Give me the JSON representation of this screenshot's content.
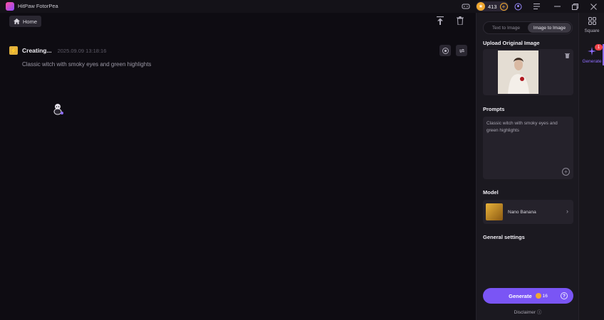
{
  "app": {
    "title": "HitPaw FotorPea"
  },
  "titlebar": {
    "coins": "413",
    "coin_plus": "+",
    "icons": [
      "gamepad-icon",
      "user-icon",
      "menu-icon",
      "minimize-icon",
      "restore-icon",
      "close-icon"
    ]
  },
  "main": {
    "home_label": "Home",
    "status_label": "Creating...",
    "timestamp": "2025.09.09   13:18:16",
    "prompt": "Classic witch with smoky eyes and green highlights"
  },
  "panel": {
    "tabs": [
      {
        "label": "Text to Image",
        "active": false
      },
      {
        "label": "Image to Image",
        "active": true
      }
    ],
    "upload_title": "Upload Original Image",
    "prompts_title": "Prompts",
    "prompt_value": "Classic witch with smoky eyes and green highlights",
    "model_title": "Model",
    "model_name": "Nano Banana",
    "general_title": "General settings",
    "generate_label": "Generate",
    "generate_cost": "16",
    "disclaimer": "Disclaimer ⓘ"
  },
  "rail": {
    "items": [
      {
        "label": "Square",
        "icon": "grid-icon"
      },
      {
        "label": "Generate",
        "icon": "sparkle-icon",
        "badge": "1"
      }
    ]
  },
  "colors": {
    "accent": "#7a55f5",
    "coin": "#f0a830",
    "badge": "#f0434a"
  }
}
